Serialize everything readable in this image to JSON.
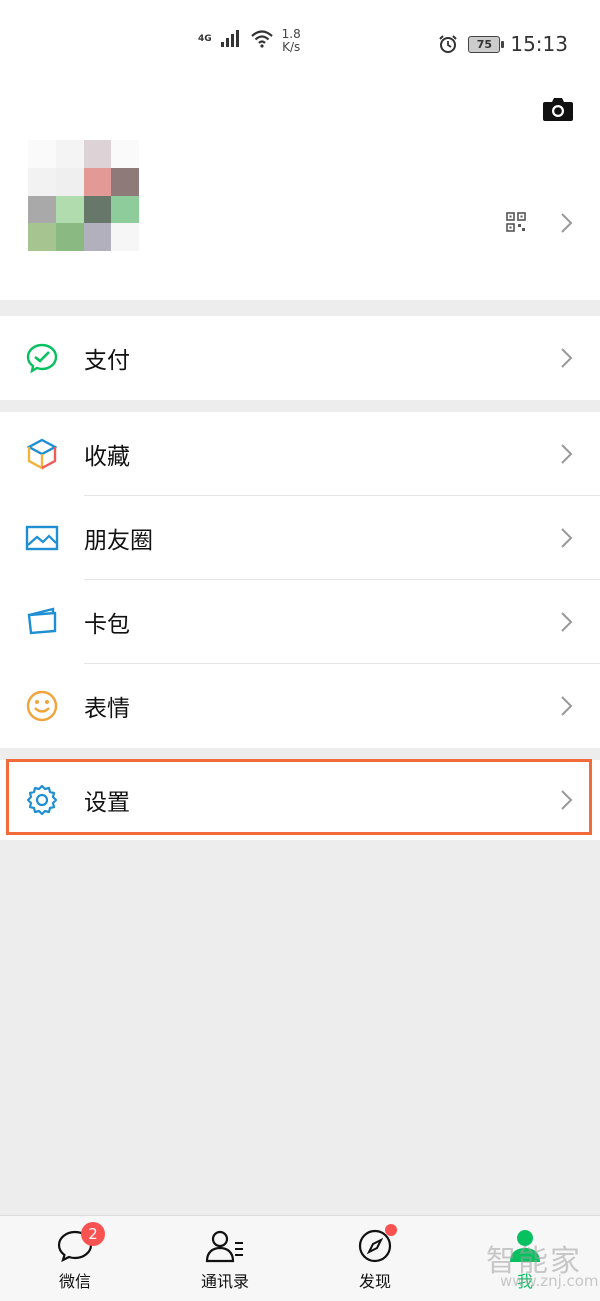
{
  "status_bar": {
    "network": "4G",
    "speed_value": "1.8",
    "speed_unit": "K/s",
    "battery": "75",
    "time": "15:13"
  },
  "profile": {
    "avatar_colors": [
      "#fafafa",
      "#f4f4f4",
      "#ddd3d6",
      "#fafafa",
      "#f2f2f2",
      "#efefef",
      "#e39a97",
      "#8e7a78",
      "#a9a9a9",
      "#b0dcae",
      "#67786a",
      "#8fcc9b",
      "#a6c48f",
      "#8bb982",
      "#b2b0bc",
      "#f6f6f6"
    ],
    "qr_icon": "qr-code-icon",
    "camera_icon": "camera-icon"
  },
  "menu": {
    "pay": {
      "label": "支付",
      "icon": "wechat-pay-icon",
      "color": "#07c160"
    },
    "favorites": {
      "label": "收藏",
      "icon": "favorites-cube-icon"
    },
    "moments": {
      "label": "朋友圈",
      "icon": "moments-photo-icon",
      "color": "#1f8fd4"
    },
    "cards": {
      "label": "卡包",
      "icon": "card-wallet-icon",
      "color": "#1f8fd4"
    },
    "stickers": {
      "label": "表情",
      "icon": "sticker-smile-icon",
      "color": "#f2a33a"
    },
    "settings": {
      "label": "设置",
      "icon": "settings-gear-icon",
      "color": "#1f8fd4"
    }
  },
  "highlight_color": "#f26b3a",
  "tabs": [
    {
      "label": "微信",
      "badge": "2",
      "icon": "chat-icon"
    },
    {
      "label": "通讯录",
      "icon": "contacts-icon"
    },
    {
      "label": "发现",
      "icon": "discover-compass-icon"
    },
    {
      "label": "我",
      "icon": "me-person-icon",
      "active": true,
      "color": "#07c160"
    }
  ],
  "watermark": {
    "text": "智能家",
    "sub": "www.znj.com"
  }
}
